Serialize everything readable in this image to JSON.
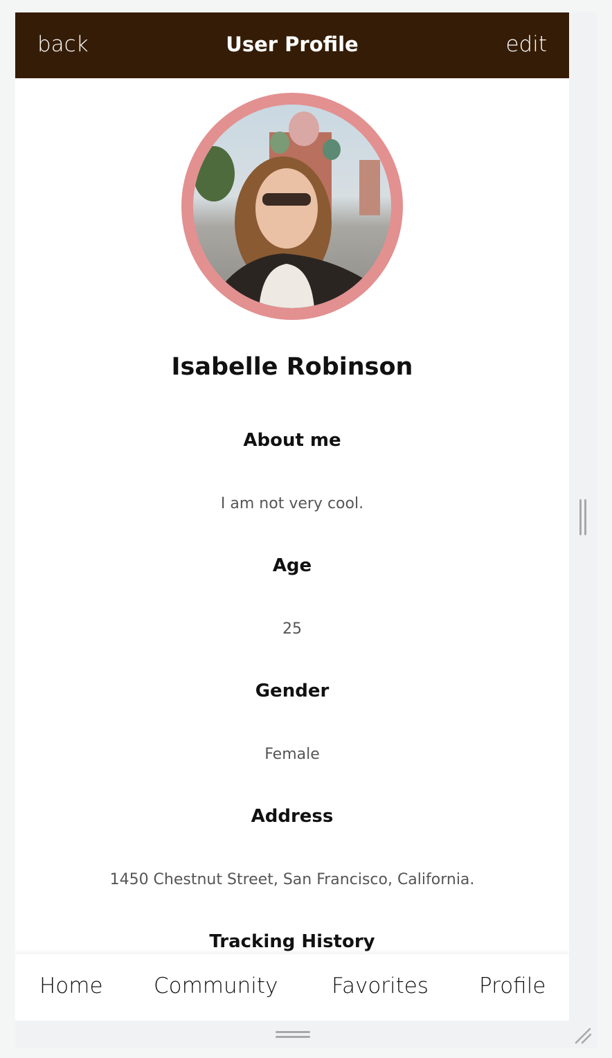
{
  "header": {
    "back_label": "back",
    "title": "User Profile",
    "edit_label": "edit",
    "background": "#351c06"
  },
  "profile": {
    "name": "Isabelle Robinson",
    "avatar_border_color": "#e39090",
    "fields": [
      {
        "label": "About me",
        "value": "I am not very cool."
      },
      {
        "label": "Age",
        "value": "25"
      },
      {
        "label": "Gender",
        "value": "Female"
      },
      {
        "label": "Address",
        "value": "1450 Chestnut Street, San Francisco, California."
      },
      {
        "label": "Tracking History"
      }
    ]
  },
  "tabbar": {
    "items": [
      {
        "label": "Home"
      },
      {
        "label": "Community"
      },
      {
        "label": "Favorites"
      },
      {
        "label": "Profile"
      }
    ]
  }
}
